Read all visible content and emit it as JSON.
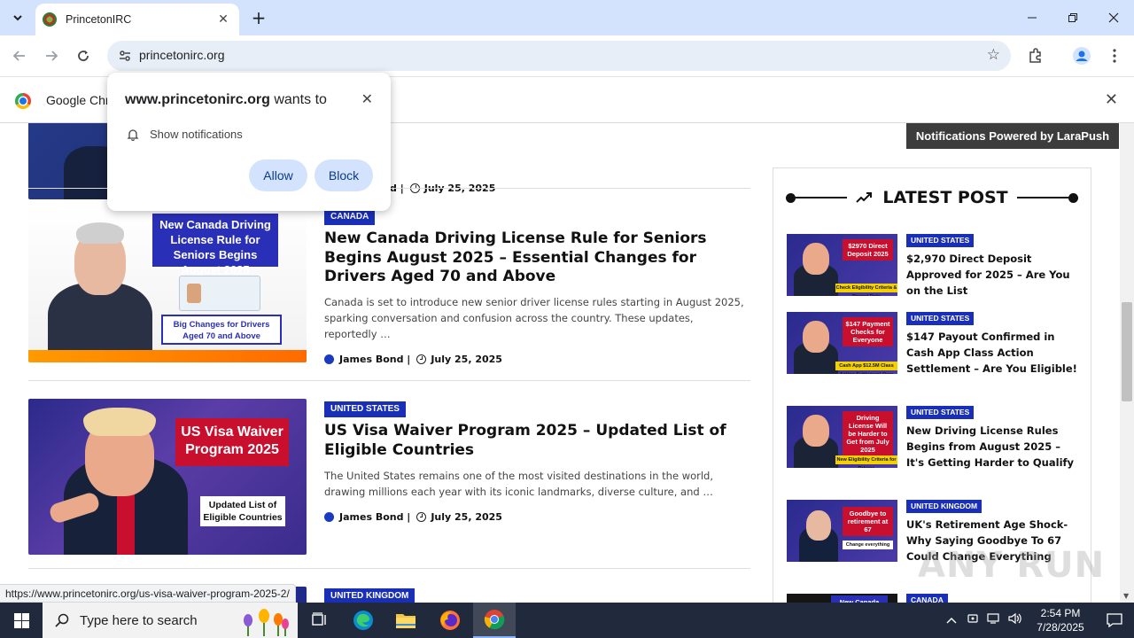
{
  "browser": {
    "tab_title": "PrincetonIRC",
    "url": "princetonirc.org",
    "infobar_text": "Google Chrome",
    "status_url": "https://www.princetonirc.org/us-visa-waiver-program-2025-2/"
  },
  "permission_popup": {
    "site": "www.princetonirc.org",
    "wants_to": " wants to",
    "permission": "Show notifications",
    "allow_label": "Allow",
    "block_label": "Block"
  },
  "articles": [
    {
      "meta_author_partial": "d |",
      "date": "July 25, 2025"
    },
    {
      "category": "CANADA",
      "title": "New Canada Driving License Rule for Seniors Begins August 2025 – Essential Changes for Drivers Aged 70 and Above",
      "excerpt": "Canada is set to introduce new senior driver license rules starting in August 2025, sparking conversation and confusion across the country. These updates, reportedly …",
      "author": "James Bond |",
      "date": "July 25, 2025",
      "thumb_heading": "New Canada Driving License Rule for Seniors Begins August 2025",
      "thumb_sub": "Big Changes for Drivers Aged 70 and Above"
    },
    {
      "category": "UNITED STATES",
      "title": "US Visa Waiver Program 2025 – Updated List of Eligible Countries",
      "excerpt": "The United States remains one of the most visited destinations in the world, drawing millions each year with its iconic landmarks, diverse culture, and …",
      "author": "James Bond |",
      "date": "July 25, 2025",
      "thumb_heading": "US Visa Waiver Program 2025",
      "thumb_sub": "Updated List of Eligible Countries"
    },
    {
      "category": "UNITED KINGDOM"
    }
  ],
  "sidebar": {
    "powered_by": "Notifications Powered by LaraPush",
    "heading": "LATEST POST",
    "items": [
      {
        "category": "UNITED STATES",
        "title": "$2,970 Direct Deposit Approved for 2025 – Are You on the List",
        "thumb_tag": "$2970 Direct Deposit 2025",
        "thumb_strip": "Check Eligibility Criteria & Payout Date"
      },
      {
        "category": "UNITED STATES",
        "title": "$147 Payout Confirmed in Cash App Class Action Settlement – Are You Eligible!",
        "thumb_tag": "$147 Payment Checks for Everyone",
        "thumb_strip": "Cash App $12.5M Class Action Settlement Over Spam Texts"
      },
      {
        "category": "UNITED STATES",
        "title": "New Driving License Rules Begins from August 2025 – It's Getting Harder to Qualify",
        "thumb_tag": "Driving License Will be Harder to Get from July 2025",
        "thumb_strip": "New Eligibility Criteria for Drivers"
      },
      {
        "category": "UNITED KINGDOM",
        "title": "UK's Retirement Age Shock- Why Saying Goodbye To 67 Could Change Everything",
        "thumb_tag": "Goodbye to retirement at 67",
        "thumb_strip": "Change everything"
      },
      {
        "category": "CANADA",
        "thumb_tag": "New Canada Driving"
      }
    ]
  },
  "watermark": "ANY RUN",
  "taskbar": {
    "search_placeholder": "Type here to search",
    "time": "2:54 PM",
    "date": "7/28/2025"
  }
}
